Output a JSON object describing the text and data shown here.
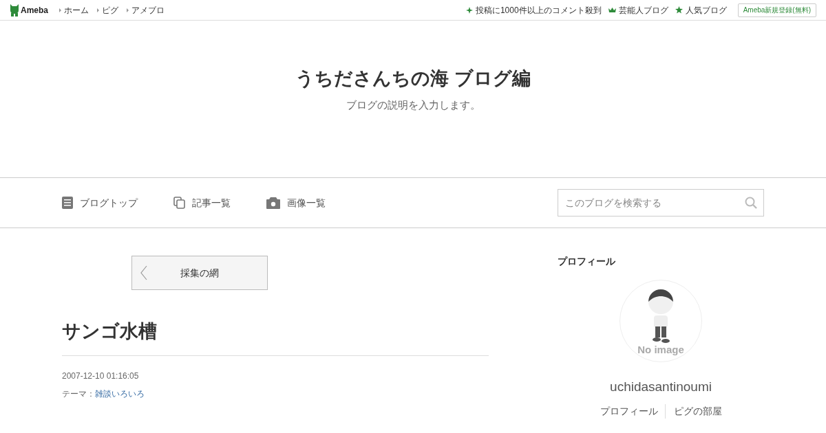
{
  "topbar": {
    "logo": "Ameba",
    "links": [
      "ホーム",
      "ピグ",
      "アメブロ"
    ],
    "right_links": [
      {
        "kind": "sparkle",
        "label": "投稿に1000件以上のコメント殺到"
      },
      {
        "kind": "crown",
        "label": "芸能人ブログ"
      },
      {
        "kind": "star",
        "label": "人気ブログ"
      }
    ],
    "signup": "Ameba新規登録(無料)"
  },
  "header": {
    "title": "うちださんちの海 ブログ編",
    "description": "ブログの説明を入力します。"
  },
  "nav": {
    "items": [
      {
        "kind": "doc",
        "label": "ブログトップ"
      },
      {
        "kind": "copy",
        "label": "記事一覧"
      },
      {
        "kind": "camera",
        "label": "画像一覧"
      }
    ],
    "search": {
      "placeholder": "このブログを検索する"
    }
  },
  "article": {
    "prev": "採集の網",
    "title": "サンゴ水槽",
    "date": "2007-12-10 01:16:05",
    "theme_label": "テーマ：",
    "theme": "雑談いろいろ"
  },
  "profile": {
    "heading": "プロフィール",
    "avatar_text": "No image",
    "name": "uchidasantinoumi",
    "links": [
      "プロフィール",
      "ピグの部屋"
    ]
  }
}
